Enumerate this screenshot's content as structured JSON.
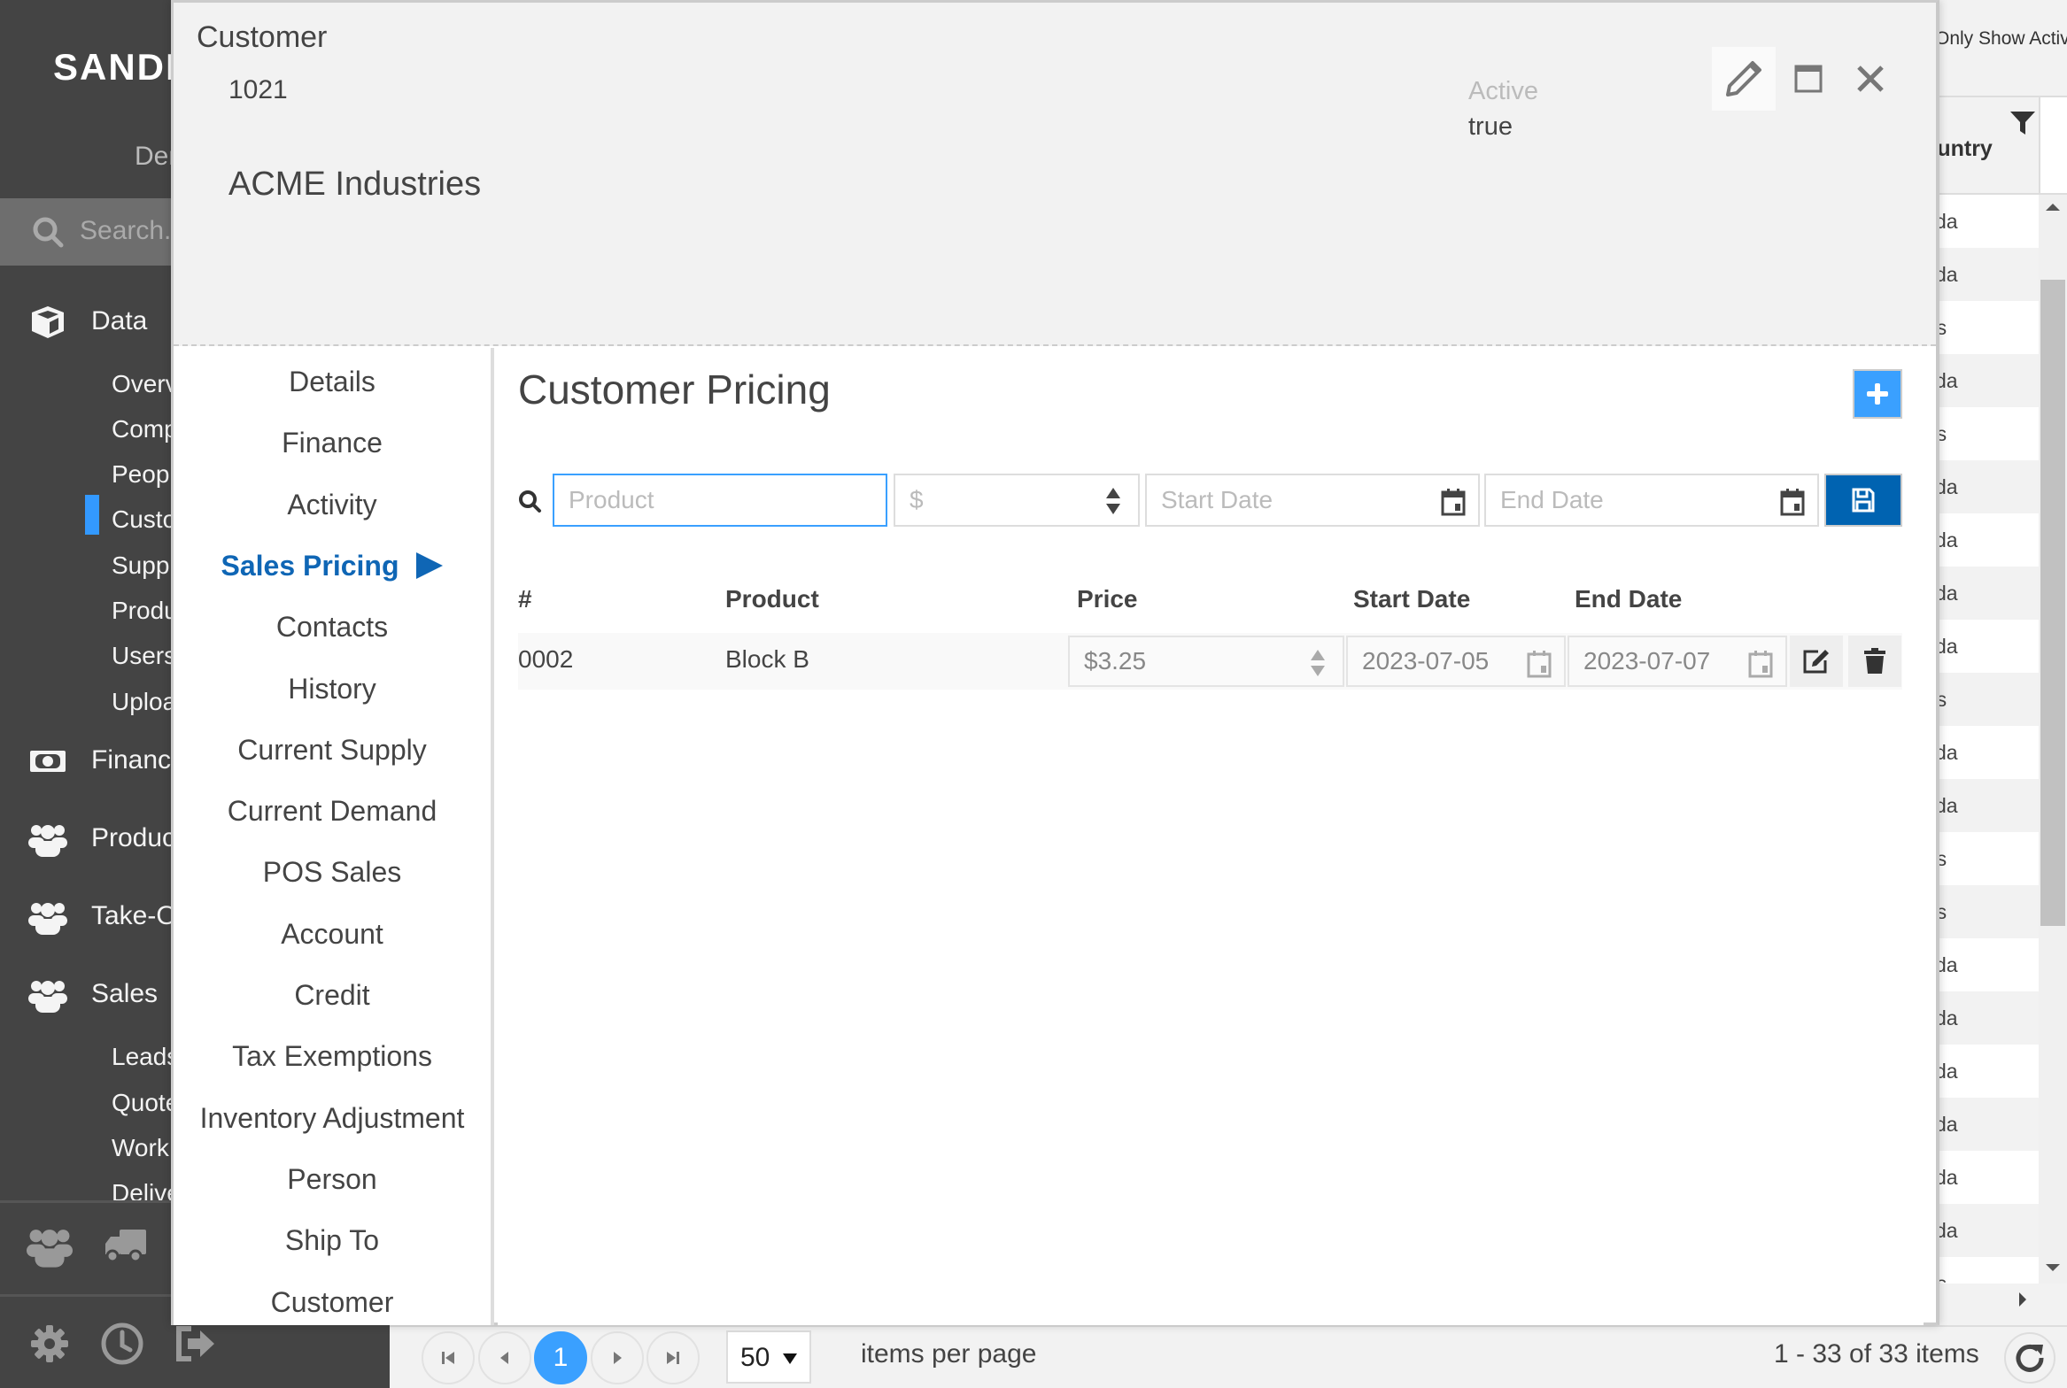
{
  "app": {
    "logo": "SANDI",
    "demo_label": "Demo",
    "search_placeholder": "Search...",
    "nav": {
      "data": {
        "label": "Data",
        "icon": "cube-icon",
        "items": [
          "Overview",
          "Companies",
          "People",
          "Customers",
          "Suppliers",
          "Products",
          "Users",
          "Uploads"
        ],
        "active_item": "Customers"
      },
      "finance": {
        "label": "Finance",
        "icon": "money-icon"
      },
      "production": {
        "label": "Production",
        "icon": "users-icon"
      },
      "take_off": {
        "label": "Take-Off",
        "icon": "users-icon"
      },
      "sales": {
        "label": "Sales",
        "icon": "users-icon",
        "items": [
          "Leads",
          "Quotes",
          "Work Orders",
          "Deliveries"
        ]
      }
    },
    "footer_icons": [
      "users-icon",
      "truck-icon",
      "gear-icon",
      "clock-icon",
      "sign-out-icon"
    ]
  },
  "background_grid": {
    "show_active_label": "Only Show Active",
    "column_header": "Country",
    "rows": [
      "Canada",
      "Canada",
      "United States",
      "Canada",
      "United States",
      "Canada",
      "Canada",
      "Canada",
      "Canada",
      "United States",
      "Canada",
      "Canada",
      "United States",
      "United States",
      "Canada",
      "Canada",
      "Canada",
      "Canada",
      "Canada",
      "Canada",
      "United States"
    ]
  },
  "pager": {
    "current_page": "1",
    "per_page": "50",
    "per_page_label": "items per page",
    "items_count": "1 - 33 of 33 items"
  },
  "modal": {
    "title": "Customer",
    "customer_id": "1021",
    "customer_name": "ACME Industries",
    "active_label": "Active",
    "active_value": "true",
    "nav_items": [
      "Details",
      "Finance",
      "Activity",
      "Sales Pricing",
      "Contacts",
      "History",
      "Current Supply",
      "Current Demand",
      "POS Sales",
      "Account",
      "Credit",
      "Tax Exemptions",
      "Inventory Adjustment",
      "Person",
      "Ship To",
      "Customer"
    ],
    "active_nav": "Sales Pricing",
    "content": {
      "title": "Customer Pricing",
      "filters": {
        "product_placeholder": "Product",
        "price_placeholder": "$",
        "start_date_placeholder": "Start Date",
        "end_date_placeholder": "End Date"
      },
      "columns": [
        "#",
        "Product",
        "Price",
        "Start Date",
        "End Date"
      ],
      "rows": [
        {
          "number": "0002",
          "product": "Block B",
          "price": "$3.25",
          "start_date": "2023-07-05",
          "end_date": "2023-07-07"
        }
      ]
    }
  },
  "colors": {
    "accent": "#3aa0ff",
    "primary_dark": "#0063b1",
    "active_nav_text": "#0f66b5",
    "sidebar_bg": "#444444"
  }
}
